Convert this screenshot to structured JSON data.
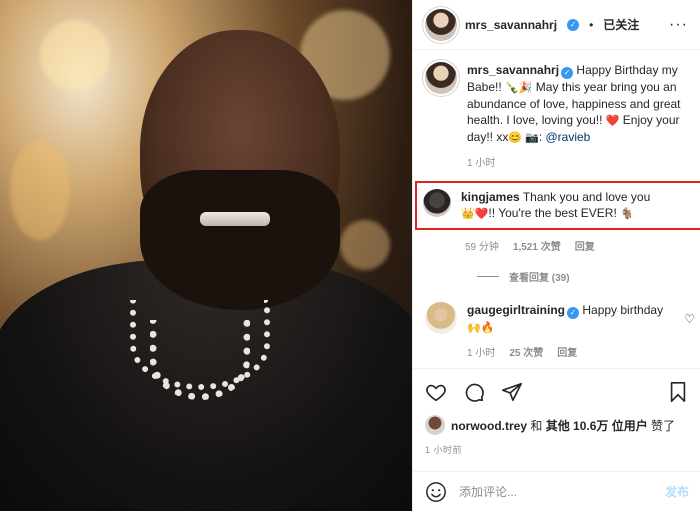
{
  "photo": {
    "alt_subject": ""
  },
  "header": {
    "username": "mrs_savannahrj",
    "separator": "•",
    "follow_label": "已关注",
    "more_label": "···"
  },
  "caption": {
    "username": "mrs_savannahrj",
    "text_part1": "Happy Birthday my Babe!! ",
    "emoji1": "🍾🎉",
    "text_part2": " May this year bring you an abundance of love, happiness and great health. I love, loving you!! ",
    "emoji2": "❤️",
    "text_part3": " Enjoy your day!! xx",
    "emoji3": "😊 📷",
    "mention": ": @ravieb",
    "time": "1 小时"
  },
  "comments": [
    {
      "username": "kingjames",
      "text_a": "Thank you and love you ",
      "emoji_a": "👑❤️",
      "text_b": "!! You're the best EVER! ",
      "emoji_b": "🐐",
      "time": "59 分钟",
      "likes": "1,521 次赞",
      "reply": "回复",
      "view_replies": "查看回复 (39)"
    },
    {
      "username": "gaugegirltraining",
      "text_a": "Happy birthday",
      "emoji_a": "🙌🔥",
      "time": "1 小时",
      "likes": "25 次赞",
      "reply": "回复"
    }
  ],
  "likes_line": {
    "user": "norwood.trey",
    "and": " 和 ",
    "others": "其他 10.6万 位用户",
    "suffix": " 赞了"
  },
  "post_time": "1 小时前",
  "composer": {
    "placeholder": "添加评论...",
    "post_label": "发布"
  }
}
